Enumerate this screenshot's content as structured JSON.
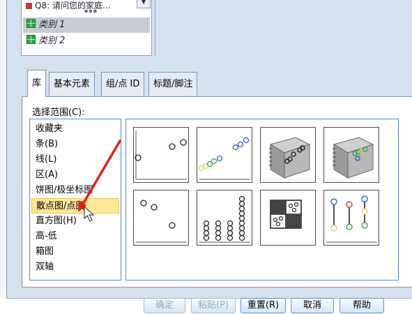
{
  "variables": {
    "partial_item": "Q8: 请问您的家庭…",
    "categories": [
      {
        "label": "类别 1",
        "selected": true
      },
      {
        "label": "类别 2",
        "selected": false
      }
    ]
  },
  "tabs": [
    {
      "label": "库",
      "active": true
    },
    {
      "label": "基本元素",
      "active": false
    },
    {
      "label": "组/点 ID",
      "active": false
    },
    {
      "label": "标题/脚注",
      "active": false
    }
  ],
  "gallery": {
    "range_label": "选择范围(C):",
    "items": [
      {
        "label": "收藏夹"
      },
      {
        "label": "条(B)"
      },
      {
        "label": "线(L)"
      },
      {
        "label": "区(A)"
      },
      {
        "label": "饼图/极坐标图"
      },
      {
        "label": "散点图/点图",
        "selected": true
      },
      {
        "label": "直方图(H)"
      },
      {
        "label": "高-低"
      },
      {
        "label": "箱图"
      },
      {
        "label": "双轴"
      }
    ],
    "thumbnails": [
      "simple-scatter-icon",
      "grouped-scatter-icon",
      "simple-3d-scatter-icon",
      "grouped-3d-scatter-icon",
      "summary-point-plot-icon",
      "simple-dot-plot-icon",
      "scatterplot-matrix-icon",
      "drop-line-icon"
    ]
  },
  "buttons": {
    "ok": "确定",
    "paste": "粘贴(P)",
    "reset": "重置(R)",
    "cancel": "取消",
    "help": "帮助"
  },
  "colors": {
    "dialog_bg": "#d6e1ee",
    "selected_item_bg": "#ffe799",
    "list_border": "#4d8fbf",
    "annotation_arrow": "#e02020",
    "scatter_green": "#2fa84a",
    "scatter_blue": "#3060c0",
    "scatter_yellow": "#d8d060"
  }
}
